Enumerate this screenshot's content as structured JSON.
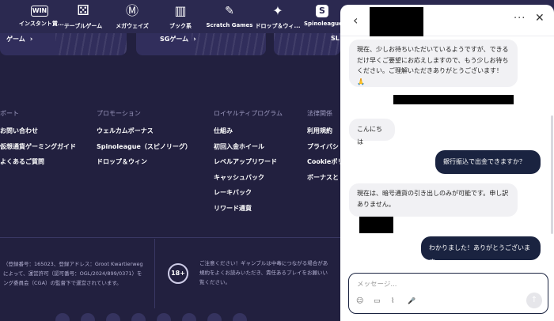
{
  "nav": {
    "items": [
      {
        "icon": "win-icon",
        "glyph": "WIN",
        "label": "インスタント賞..."
      },
      {
        "icon": "dice-icon",
        "glyph": "⚄",
        "label": "テーブルゲーム"
      },
      {
        "icon": "megaways-icon",
        "glyph": "Ⓜ",
        "label": "メガウェイズ"
      },
      {
        "icon": "book-icon",
        "glyph": "▥",
        "label": "ブック系"
      },
      {
        "icon": "scratch-icon",
        "glyph": "✎",
        "label": "Scratch Games"
      },
      {
        "icon": "drops-wins-icon",
        "glyph": "✦",
        "label": "ドロップ＆ウィ..."
      },
      {
        "icon": "spinoleague-icon",
        "glyph": "S",
        "label": "Spinoleague"
      }
    ]
  },
  "banners": [
    {
      "text": "ゲーム",
      "chevron": "›"
    },
    {
      "text": "SGゲーム",
      "chevron": "›"
    },
    {
      "text": "SL",
      "chevron": ""
    }
  ],
  "footer": {
    "columns": [
      {
        "heading": "ポート",
        "links": [
          "お問い合わせ",
          "仮想通貨ゲーミングガイド",
          "よくあるご質問"
        ]
      },
      {
        "heading": "プロモーション",
        "links": [
          "ウェルカムボーナス",
          "Spinoleague（スピノリーグ）",
          "ドロップ＆ウィン"
        ]
      },
      {
        "heading": "ロイヤルティプログラム",
        "links": [
          "仕組み",
          "初回入金ホイール",
          "レベルアップリワード",
          "キャッシュバック",
          "レーキバック",
          "リワード通貨"
        ]
      },
      {
        "heading": "法律関係",
        "links": [
          "利用規約",
          "プライバシ",
          "Cookieポリ",
          "ボーナスと"
        ]
      }
    ],
    "legal_lines": [
      "（登録番号：165023、登録アドレス：Groot Kwartierweg",
      "によって、運営許可（認可番号：OGL/2024/899/0371）を",
      "ング委員会（CGA）の監督下で運営されています。"
    ],
    "age_badge": "18+",
    "warning_lines": [
      "ご注意ください！ギャンブルは中毒につながる場合があ",
      "規約をよくお読みいただき、責任あるプレイをお願いい",
      "覧ください。"
    ]
  },
  "chat": {
    "back_icon": "‹",
    "more_icon": "···",
    "close_icon": "✕",
    "messages": [
      {
        "from": "agent",
        "text": "現在、少しお待ちいただいているようですが、できるだけ早くご要望にお応えしますので、もう少しお待ちください。ご理解いただきありがとうございます！🙏"
      },
      {
        "from": "agent",
        "text": "こんにちは"
      },
      {
        "from": "user",
        "text": "銀行振込で出金できますか？"
      },
      {
        "from": "agent",
        "text": "現在は、暗号通貨の引き出しのみが可能です。申し訳ありません。"
      },
      {
        "from": "user",
        "text": "わかりました！ありがとうございます。"
      }
    ],
    "input_placeholder": "メッセージ...",
    "tools": [
      {
        "icon": "emoji-icon",
        "glyph": "☺"
      },
      {
        "icon": "gif-icon",
        "glyph": "▭"
      },
      {
        "icon": "attach-icon",
        "glyph": "⌇"
      },
      {
        "icon": "microphone-icon",
        "glyph": "🎤"
      }
    ],
    "send_icon": "↑"
  }
}
